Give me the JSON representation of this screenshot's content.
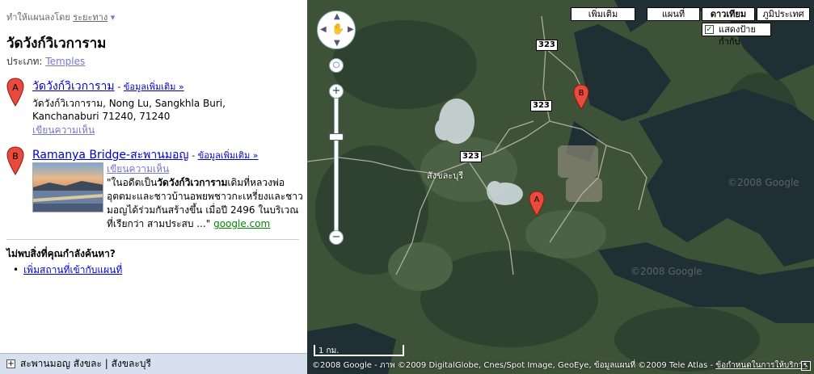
{
  "panel": {
    "attribution_text": "ทำให้แผนลงโดย",
    "attribution_link": "ระยะทาง",
    "place_title": "วัดวังก์วิเวการาม",
    "category_label": "ประเภท:",
    "category_link": "Temples",
    "results": [
      {
        "marker": "A",
        "name": "วัดวังก์วิเวการาม",
        "more_link": "ข้อมูลเพิ่มเติม »",
        "address_line1": "วัดวังก์วิเวการาม, Nong Lu, Sangkhla Buri,",
        "address_line2": "Kanchanaburi 71240, 71240",
        "review_link": "เขียนความเห็น"
      },
      {
        "marker": "B",
        "name": "Ramanya Bridge-สะพานมอญ",
        "more_link": "ข้อมูลเพิ่มเติม »",
        "review_link": "เขียนความเห็น",
        "snippet_pre": "\"ในอดีตเป็น",
        "snippet_highlight": "วัดวังก์วิเวการาม",
        "snippet_post": "เดิมที่หลวงพ่ออุตตมะและชาวบ้านอพยพชาวกะเหรี่ยงและชาวมอญได้ร่วมกันสร้างขึ้น เมื่อปี 2496 ในบริเวณที่เรียกว่า สามประสบ ...\"",
        "snippet_source": "google.com"
      }
    ],
    "notfound_text": "ไม่พบสิ่งที่คุณกำลังค้นหา?",
    "addplace_link": "เพิ่มสถานที่เข้ากับแผนที่",
    "footer_text": "สะพานมอญ สังขละ | สังขละบุรี"
  },
  "map": {
    "type_buttons": [
      "เพิ่มเติม",
      "แผนที่",
      "ดาวเทียม",
      "ภูมิประเทศ"
    ],
    "selected_type": "ดาวเทียม",
    "labels_checkbox": "แสดงป้ายกำกับ",
    "labels_checked": true,
    "road_shields": [
      "323",
      "323",
      "323"
    ],
    "town_label": "สังขละบุรี",
    "pins": [
      "A",
      "B"
    ],
    "scale_label": "1 กม.",
    "copyright_text": "©2008 Google - ภาพ ©2009 DigitalGlobe, Cnes/Spot Image, GeoEye, ข้อมูลแผนที่ ©2009 Tele Atlas -",
    "terms_link": "ข้อกำหนดในการให้บริการ",
    "watermarks": [
      "©2008 Google",
      "©2008 Google"
    ],
    "colors": {
      "water": "#1f2f33",
      "forest": "#3e5238",
      "pin": "#e84b3c",
      "link": "#0000cc"
    }
  }
}
